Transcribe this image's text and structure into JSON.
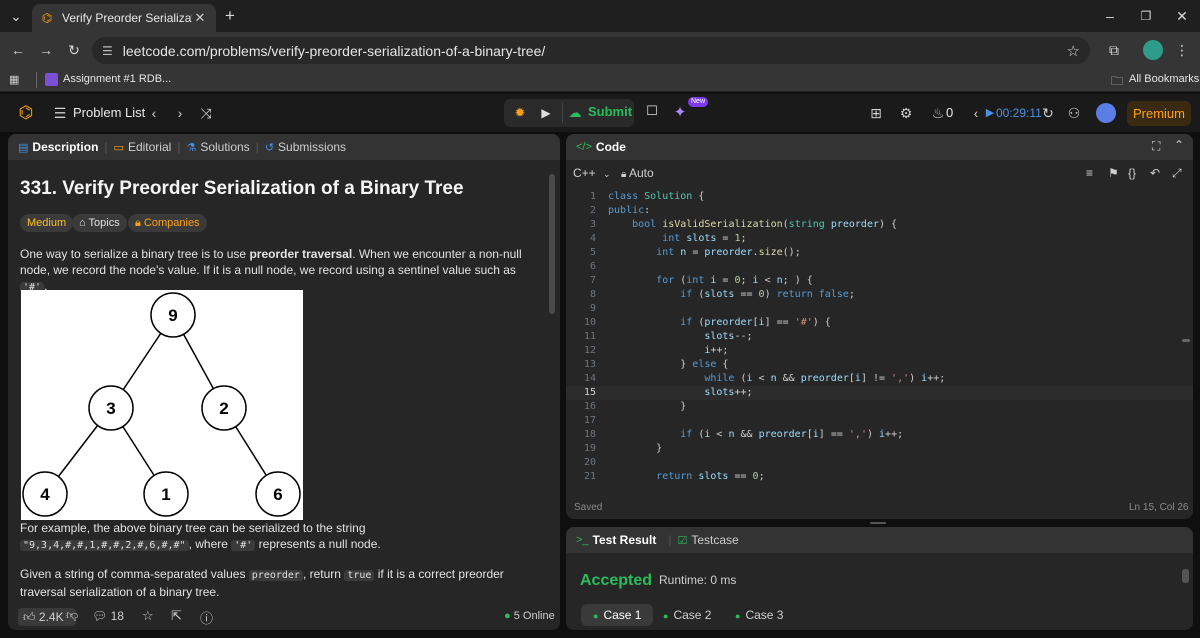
{
  "browser": {
    "tab_title": "Verify Preorder Serialization of a",
    "url": "leetcode.com/problems/verify-preorder-serialization-of-a-binary-tree/",
    "bookmark_item": "Assignment #1 RDB...",
    "all_bookmarks": "All Bookmarks"
  },
  "navbar": {
    "problem_list": "Problem List",
    "submit": "Submit",
    "new_badge": "New",
    "streak_count": "0",
    "timer": "00:29:11",
    "premium": "Premium"
  },
  "left": {
    "tabs": [
      "Description",
      "Editorial",
      "Solutions",
      "Submissions"
    ],
    "title": "331. Verify Preorder Serialization of a Binary Tree",
    "difficulty": "Medium",
    "topics": "Topics",
    "companies": "Companies",
    "intro_pre": "One way to serialize a binary tree is to use ",
    "intro_bold": "preorder traversal",
    "intro_post": ". When we encounter a non-null node, we record the node's value. If it is a null node, we record using a sentinel value such as ",
    "intro_code": "'#'",
    "intro_end": ".",
    "example_pre": "For example, the above binary tree can be serialized to the string ",
    "example_code": "\"9,3,4,#,#,1,#,#,2,#,6,#,#\"",
    "example_mid": ", where ",
    "example_code2": "'#'",
    "example_end": " represents a null node.",
    "given_pre": "Given a string of comma-separated values ",
    "given_code1": "preorder",
    "given_mid": ", return ",
    "given_code2": "true",
    "given_end": " if it is a correct preorder traversal serialization of a binary tree.",
    "likes": "2.4K",
    "comments": "18",
    "online": "5 Online"
  },
  "tree": {
    "nodes": [
      "9",
      "3",
      "2",
      "4",
      "1",
      "6"
    ]
  },
  "editor": {
    "title": "Code",
    "language": "C++",
    "mode": "Auto",
    "status_left": "Saved",
    "status_right": "Ln 15, Col 26",
    "line_numbers": [
      "1",
      "2",
      "3",
      "4",
      "5",
      "6",
      "7",
      "8",
      "9",
      "10",
      "11",
      "12",
      "13",
      "14",
      "15",
      "16",
      "17",
      "18",
      "19",
      "20",
      "21"
    ]
  },
  "test": {
    "tab_result": "Test Result",
    "tab_testcase": "Testcase",
    "verdict": "Accepted",
    "runtime": "Runtime: 0 ms",
    "cases": [
      "Case 1",
      "Case 2",
      "Case 3"
    ]
  },
  "colors": {
    "accent": "#ffa116",
    "accepted": "#2cbb5d",
    "keyword": "#569cd6"
  }
}
